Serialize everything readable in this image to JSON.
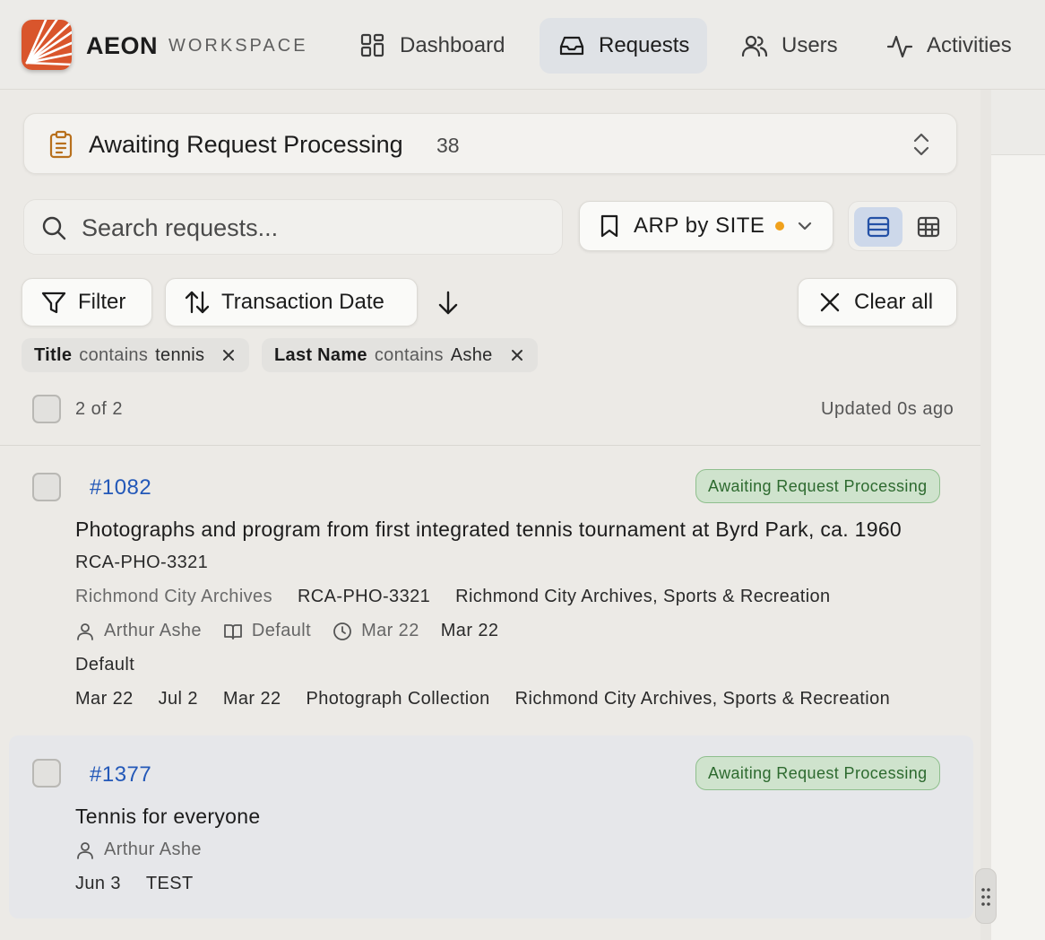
{
  "app": {
    "brand": "AEON",
    "brand_sub": "WORKSPACE"
  },
  "nav": {
    "dashboard": "Dashboard",
    "requests": "Requests",
    "users": "Users",
    "activities": "Activities"
  },
  "queue": {
    "title": "Awaiting Request Processing",
    "count": "38"
  },
  "search": {
    "placeholder": "Search requests...",
    "value": ""
  },
  "saved_view": {
    "label": "ARP by SITE",
    "indicator_color": "#f0a11c"
  },
  "toolbar": {
    "filter_label": "Filter",
    "sort_label": "Transaction Date",
    "clear_label": "Clear all"
  },
  "filters": [
    {
      "field": "Title",
      "op": "contains",
      "value": "tennis"
    },
    {
      "field": "Last Name",
      "op": "contains",
      "value": "Ashe"
    }
  ],
  "list_meta": {
    "count_text": "2 of 2",
    "updated_text": "Updated 0s ago"
  },
  "requests": [
    {
      "id": "#1082",
      "status": "Awaiting Request Processing",
      "title": "Photographs and program from first integrated tennis tournament at Byrd Park, ca. 1960",
      "call_number": "RCA-PHO-3321",
      "repository": "Richmond City Archives",
      "call_number_2": "RCA-PHO-3321",
      "location": "Richmond City Archives, Sports & Recreation",
      "user": "Arthur Ashe",
      "queue": "Default",
      "created": "Mar 22",
      "date2": "Mar 22",
      "type": "Default",
      "d1": "Mar 22",
      "d2": "Jul 2",
      "d3": "Mar 22",
      "format": "Photograph Collection",
      "location_2": "Richmond City Archives, Sports & Recreation"
    },
    {
      "id": "#1377",
      "status": "Awaiting Request Processing",
      "title": "Tennis for everyone",
      "user": "Arthur Ashe",
      "date": "Jun 3",
      "note": "TEST"
    }
  ],
  "colors": {
    "accent": "#2358b8",
    "status_bg": "#cfe3cd",
    "status_text": "#2d6a2f",
    "logo": "#d9552c"
  }
}
